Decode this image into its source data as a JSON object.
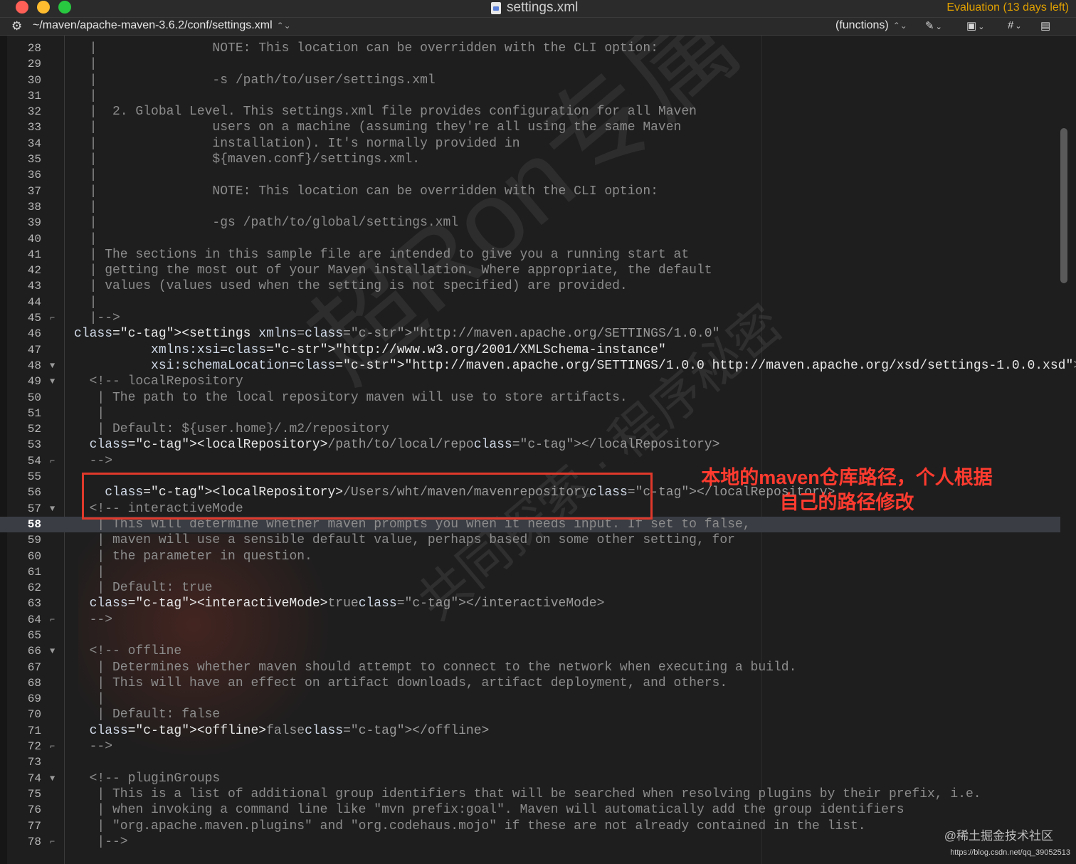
{
  "window": {
    "title": "settings.xml",
    "evaluation": "Evaluation (13 days left)"
  },
  "navbar": {
    "path": "~/maven/apache-maven-3.6.2/conf/settings.xml",
    "functions": "(functions)"
  },
  "icons": {
    "gear": "gear-icon",
    "updown": "updown-arrows-icon",
    "pen": "pen-icon",
    "doc": "document-icon",
    "hash": "hash-icon",
    "page": "page-icon"
  },
  "colors": {
    "background": "#1e1e1e",
    "comment": "#8c8c8c",
    "tag": "#90b8dc",
    "annotation": "#e0392b",
    "evaluation": "#e0a000"
  },
  "editor": {
    "current_line": "58",
    "lines": [
      {
        "num": "28",
        "fold": "",
        "text": "  |               NOTE: This location can be overridden with the CLI option:"
      },
      {
        "num": "29",
        "fold": "",
        "text": "  |"
      },
      {
        "num": "30",
        "fold": "",
        "text": "  |               -s /path/to/user/settings.xml"
      },
      {
        "num": "31",
        "fold": "",
        "text": "  |"
      },
      {
        "num": "32",
        "fold": "",
        "text": "  |  2. Global Level. This settings.xml file provides configuration for all Maven"
      },
      {
        "num": "33",
        "fold": "",
        "text": "  |               users on a machine (assuming they're all using the same Maven"
      },
      {
        "num": "34",
        "fold": "",
        "text": "  |               installation). It's normally provided in"
      },
      {
        "num": "35",
        "fold": "",
        "text": "  |               ${maven.conf}/settings.xml."
      },
      {
        "num": "36",
        "fold": "",
        "text": "  |"
      },
      {
        "num": "37",
        "fold": "",
        "text": "  |               NOTE: This location can be overridden with the CLI option:"
      },
      {
        "num": "38",
        "fold": "",
        "text": "  |"
      },
      {
        "num": "39",
        "fold": "",
        "text": "  |               -gs /path/to/global/settings.xml"
      },
      {
        "num": "40",
        "fold": "",
        "text": "  |"
      },
      {
        "num": "41",
        "fold": "",
        "text": "  | The sections in this sample file are intended to give you a running start at"
      },
      {
        "num": "42",
        "fold": "",
        "text": "  | getting the most out of your Maven installation. Where appropriate, the default"
      },
      {
        "num": "43",
        "fold": "",
        "text": "  | values (values used when the setting is not specified) are provided."
      },
      {
        "num": "44",
        "fold": "",
        "text": "  |"
      },
      {
        "num": "45",
        "fold": "⌐",
        "text": "  |-->"
      },
      {
        "num": "46",
        "fold": "",
        "text": "<settings xmlns=\"http://maven.apache.org/SETTINGS/1.0.0\""
      },
      {
        "num": "47",
        "fold": "",
        "text": "          xmlns:xsi=\"http://www.w3.org/2001/XMLSchema-instance\""
      },
      {
        "num": "48",
        "fold": "▼",
        "text": "          xsi:schemaLocation=\"http://maven.apache.org/SETTINGS/1.0.0 http://maven.apache.org/xsd/settings-1.0.0.xsd\">"
      },
      {
        "num": "49",
        "fold": "▼",
        "text": "  <!-- localRepository"
      },
      {
        "num": "50",
        "fold": "",
        "text": "   | The path to the local repository maven will use to store artifacts."
      },
      {
        "num": "51",
        "fold": "",
        "text": "   |"
      },
      {
        "num": "52",
        "fold": "",
        "text": "   | Default: ${user.home}/.m2/repository"
      },
      {
        "num": "53",
        "fold": "",
        "text": "  <localRepository>/path/to/local/repo</localRepository>"
      },
      {
        "num": "54",
        "fold": "⌐",
        "text": "  -->"
      },
      {
        "num": "55",
        "fold": "",
        "text": ""
      },
      {
        "num": "56",
        "fold": "",
        "text": "    <localRepository>/Users/wht/maven/mavenrepository</localRepository>"
      },
      {
        "num": "57",
        "fold": "▼",
        "text": "  <!-- interactiveMode"
      },
      {
        "num": "58",
        "fold": "",
        "text": "   | This will determine whether maven prompts you when it needs input. If set to false,"
      },
      {
        "num": "59",
        "fold": "",
        "text": "   | maven will use a sensible default value, perhaps based on some other setting, for"
      },
      {
        "num": "60",
        "fold": "",
        "text": "   | the parameter in question."
      },
      {
        "num": "61",
        "fold": "",
        "text": "   |"
      },
      {
        "num": "62",
        "fold": "",
        "text": "   | Default: true"
      },
      {
        "num": "63",
        "fold": "",
        "text": "  <interactiveMode>true</interactiveMode>"
      },
      {
        "num": "64",
        "fold": "⌐",
        "text": "  -->"
      },
      {
        "num": "65",
        "fold": "",
        "text": ""
      },
      {
        "num": "66",
        "fold": "▼",
        "text": "  <!-- offline"
      },
      {
        "num": "67",
        "fold": "",
        "text": "   | Determines whether maven should attempt to connect to the network when executing a build."
      },
      {
        "num": "68",
        "fold": "",
        "text": "   | This will have an effect on artifact downloads, artifact deployment, and others."
      },
      {
        "num": "69",
        "fold": "",
        "text": "   |"
      },
      {
        "num": "70",
        "fold": "",
        "text": "   | Default: false"
      },
      {
        "num": "71",
        "fold": "",
        "text": "  <offline>false</offline>"
      },
      {
        "num": "72",
        "fold": "⌐",
        "text": "  -->"
      },
      {
        "num": "73",
        "fold": "",
        "text": ""
      },
      {
        "num": "74",
        "fold": "▼",
        "text": "  <!-- pluginGroups"
      },
      {
        "num": "75",
        "fold": "",
        "text": "   | This is a list of additional group identifiers that will be searched when resolving plugins by their prefix, i.e."
      },
      {
        "num": "76",
        "fold": "",
        "text": "   | when invoking a command line like \"mvn prefix:goal\". Maven will automatically add the group identifiers"
      },
      {
        "num": "77",
        "fold": "",
        "text": "   | \"org.apache.maven.plugins\" and \"org.codehaus.mojo\" if these are not already contained in the list."
      },
      {
        "num": "78",
        "fold": "⌐",
        "text": "   |-->"
      }
    ]
  },
  "annotation": {
    "line1": "本地的maven仓库路径，个人根据",
    "line2": "自己的路径修改"
  },
  "watermarks": {
    "big": "超Ron专属",
    "small": "共同探索 · 程序秘密",
    "site": "@稀土掘金技术社区",
    "url": "https://blog.csdn.net/qq_39052513"
  }
}
